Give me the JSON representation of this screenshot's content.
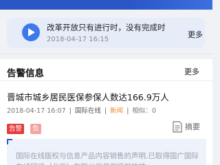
{
  "news_card": {
    "title": "改革开放只有进行时，没有完成时",
    "date": "2018-04-17 16:15",
    "more_label": "更多"
  },
  "section": {
    "title": "告警信息",
    "more_label": "更多"
  },
  "article": {
    "title": "晋城市城乡居民医保参保人数达166.9万人",
    "datetime": "2018-04-17 16:07",
    "separator": "|",
    "source": "国际在线",
    "category": "新闻",
    "similar": "相似：0",
    "tags": [
      "告警",
      "负"
    ],
    "summary_label": "摘要"
  },
  "notice": {
    "text": "国际在线版权与信息产品内容销售的声明,已取得国广国际在线网络（北京）有限公司使用授权的被"
  },
  "colors": {
    "brand_blue": "#2a56c6",
    "play_blue": "#3f78ec",
    "alert_red": "#e43b3b",
    "negative_pink": "#f4a3a3",
    "category_orange": "#e8902e"
  }
}
